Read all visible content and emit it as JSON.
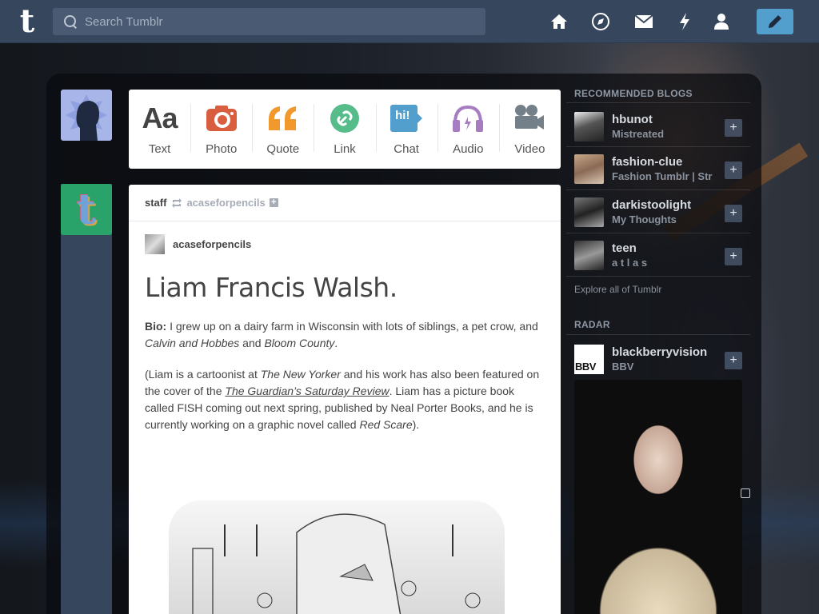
{
  "header": {
    "logo": "t",
    "search": {
      "placeholder": "Search Tumblr"
    },
    "nav": [
      "home-icon",
      "explore-icon",
      "inbox-icon",
      "activity-icon",
      "account-icon"
    ],
    "compose": "compose-icon",
    "color": "#36465d",
    "accent": "#529ecc"
  },
  "post_types": [
    {
      "label": "Text",
      "icon": "Aa",
      "color": "#444444"
    },
    {
      "label": "Photo",
      "icon": "camera-icon",
      "color": "#d95e40"
    },
    {
      "label": "Quote",
      "icon": "quote-icon",
      "color": "#f2992e"
    },
    {
      "label": "Link",
      "icon": "link-icon",
      "color": "#56bc8a"
    },
    {
      "label": "Chat",
      "icon": "hi!",
      "color": "#529ecc"
    },
    {
      "label": "Audio",
      "icon": "headphones-icon",
      "color": "#a77dc2"
    },
    {
      "label": "Video",
      "icon": "video-camera-icon",
      "color": "#748089"
    }
  ],
  "post": {
    "author": "staff",
    "reblog_source": "acaseforpencils",
    "original": "acaseforpencils",
    "title": "Liam Francis Walsh.",
    "bio_label": "Bio:",
    "bio_text": " I grew up on a dairy farm in Wisconsin with lots of siblings, a pet crow, and ",
    "bio_em1": "Calvin and Hobbes",
    "bio_and": " and ",
    "bio_em2": "Bloom County",
    "bio_end": ".",
    "p2_a": "(Liam is a cartoonist at ",
    "p2_em1": "The New Yorker",
    "p2_b": " and his work has also been featured on the cover of the ",
    "p2_link": "The Guardian’s Saturday Review",
    "p2_c": ". Liam has a picture book called FISH coming out next spring, published by Neal Porter Books, and he is currently working on a graphic novel called ",
    "p2_em2": "Red Scare",
    "p2_d": ")."
  },
  "sidebar": {
    "recommended_title": "RECOMMENDED BLOGS",
    "blogs": [
      {
        "name": "hbunot",
        "desc": "Mistreated"
      },
      {
        "name": "fashion-clue",
        "desc": "Fashion Tumblr | Str"
      },
      {
        "name": "darkistoolight",
        "desc": "My Thoughts"
      },
      {
        "name": "teen",
        "desc": "a t l a s"
      }
    ],
    "explore": "Explore all of Tumblr",
    "radar_title": "RADAR",
    "radar": {
      "name": "blackberryvision",
      "desc": "BBV",
      "thumb": "BBV"
    }
  }
}
